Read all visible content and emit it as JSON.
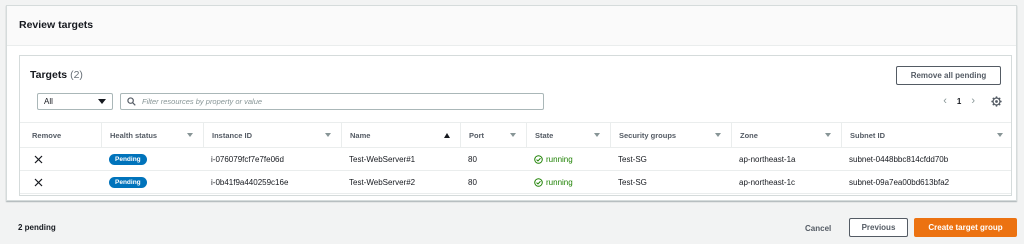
{
  "review": {
    "title": "Review targets"
  },
  "targets": {
    "title": "Targets",
    "count": "(2)",
    "remove_all_label": "Remove all pending",
    "filter_select_value": "All",
    "search_placeholder": "Filter resources by property or value",
    "page_number": "1",
    "columns": [
      "Remove",
      "Health status",
      "Instance ID",
      "Name",
      "Port",
      "State",
      "Security groups",
      "Zone",
      "Subnet ID"
    ],
    "rows": [
      {
        "health": "Pending",
        "instance_id": "i-076079fcf7e7fe06d",
        "name": "Test-WebServer#1",
        "port": "80",
        "state": "running",
        "security_group": "Test-SG",
        "zone": "ap-northeast-1a",
        "subnet_id": "subnet-0448bbc814cfdd70b"
      },
      {
        "health": "Pending",
        "instance_id": "i-0b41f9a440259c16e",
        "name": "Test-WebServer#2",
        "port": "80",
        "state": "running",
        "security_group": "Test-SG",
        "zone": "ap-northeast-1c",
        "subnet_id": "subnet-09a7ea00bd613bfa2"
      }
    ]
  },
  "footer": {
    "pending_text": "2 pending",
    "cancel_label": "Cancel",
    "previous_label": "Previous",
    "create_label": "Create target group"
  },
  "colors": {
    "accent_orange": "#ec7211",
    "pending_blue": "#0073bb",
    "running_green": "#1d8102"
  }
}
